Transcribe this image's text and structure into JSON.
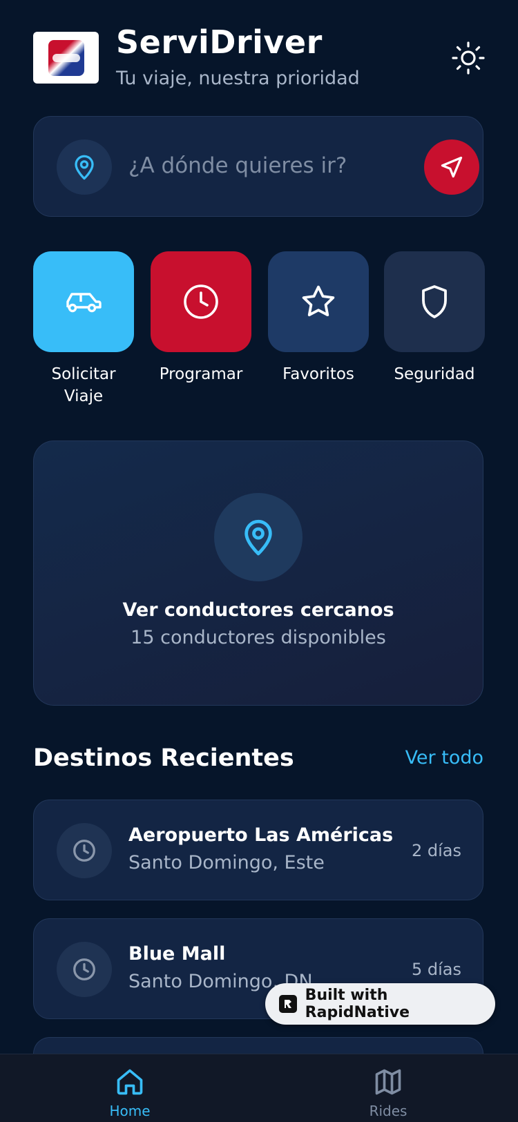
{
  "header": {
    "title": "ServiDriver",
    "subtitle": "Tu viaje, nuestra prioridad",
    "logo_icon": "servidriver-logo",
    "theme_icon": "sun-icon"
  },
  "search": {
    "placeholder": "¿A dónde quieres ir?",
    "pin_icon": "map-pin-icon",
    "go_icon": "navigation-arrow-icon"
  },
  "quick_actions": [
    {
      "label_line1": "Solicitar",
      "label_line2": "Viaje",
      "icon": "car-icon",
      "color": "#38bdf8"
    },
    {
      "label_line1": "Programar",
      "label_line2": "",
      "icon": "clock-icon",
      "color": "#c8102e"
    },
    {
      "label_line1": "Favoritos",
      "label_line2": "",
      "icon": "star-icon",
      "color": "#1e3a66"
    },
    {
      "label_line1": "Seguridad",
      "label_line2": "",
      "icon": "shield-icon",
      "color": "#1e2f4d"
    }
  ],
  "nearby": {
    "title": "Ver conductores cercanos",
    "subtitle": "15 conductores disponibles",
    "icon": "map-pin-icon"
  },
  "recent": {
    "title": "Destinos Recientes",
    "see_all": "Ver todo",
    "items": [
      {
        "name": "Aeropuerto Las Américas",
        "address": "Santo Domingo, Este",
        "time": "2 días",
        "icon": "clock-icon"
      },
      {
        "name": "Blue Mall",
        "address": "Santo Domingo, DN",
        "time": "5 días",
        "icon": "clock-icon"
      }
    ]
  },
  "badge": {
    "text": "Built with RapidNative"
  },
  "bottom_nav": [
    {
      "label": "Home",
      "icon": "home-icon",
      "active": true
    },
    {
      "label": "Rides",
      "icon": "map-icon",
      "active": false
    }
  ],
  "colors": {
    "background": "#06152a",
    "accent_blue": "#38bdf8",
    "accent_red": "#c8102e",
    "card": "#132544"
  }
}
